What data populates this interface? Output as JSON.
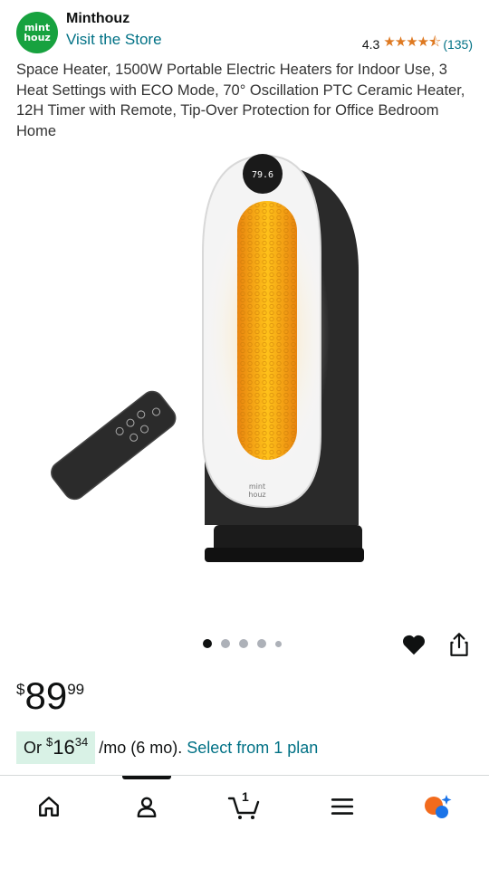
{
  "brand": {
    "logo_line1": "mint",
    "logo_line2": "houz",
    "name": "Minthouz",
    "visit_store": "Visit the Store"
  },
  "rating": {
    "value": "4.3",
    "stars": "★★★★⯪",
    "count": "(135)"
  },
  "product": {
    "title": "Space Heater, 1500W Portable Electric Heaters for Indoor Use, 3 Heat Settings with ECO Mode, 70° Oscillation PTC Ceramic Heater, 12H Timer with Remote, Tip-Over Protection for Office Bedroom Home",
    "display_reading": "79.6",
    "body_logo_line1": "mint",
    "body_logo_line2": "houz"
  },
  "carousel": {
    "total_images": 5,
    "active_index": 0
  },
  "price": {
    "currency": "$",
    "whole": "89",
    "fraction": "99"
  },
  "monthly": {
    "prefix": "Or ",
    "currency": "$",
    "whole": "16",
    "fraction": "34",
    "suffix": "/mo (6 mo).",
    "link": "Select from 1 plan"
  },
  "nav": {
    "cart_count": "1",
    "items": [
      "home-icon",
      "account-icon",
      "cart-icon",
      "menu-icon",
      "assistant-icon"
    ]
  },
  "colors": {
    "link": "#007185",
    "star": "#de7921",
    "brand_green": "#17a23f",
    "installment_bg": "#d9f2e6",
    "heater_glow": "#f5a623"
  }
}
